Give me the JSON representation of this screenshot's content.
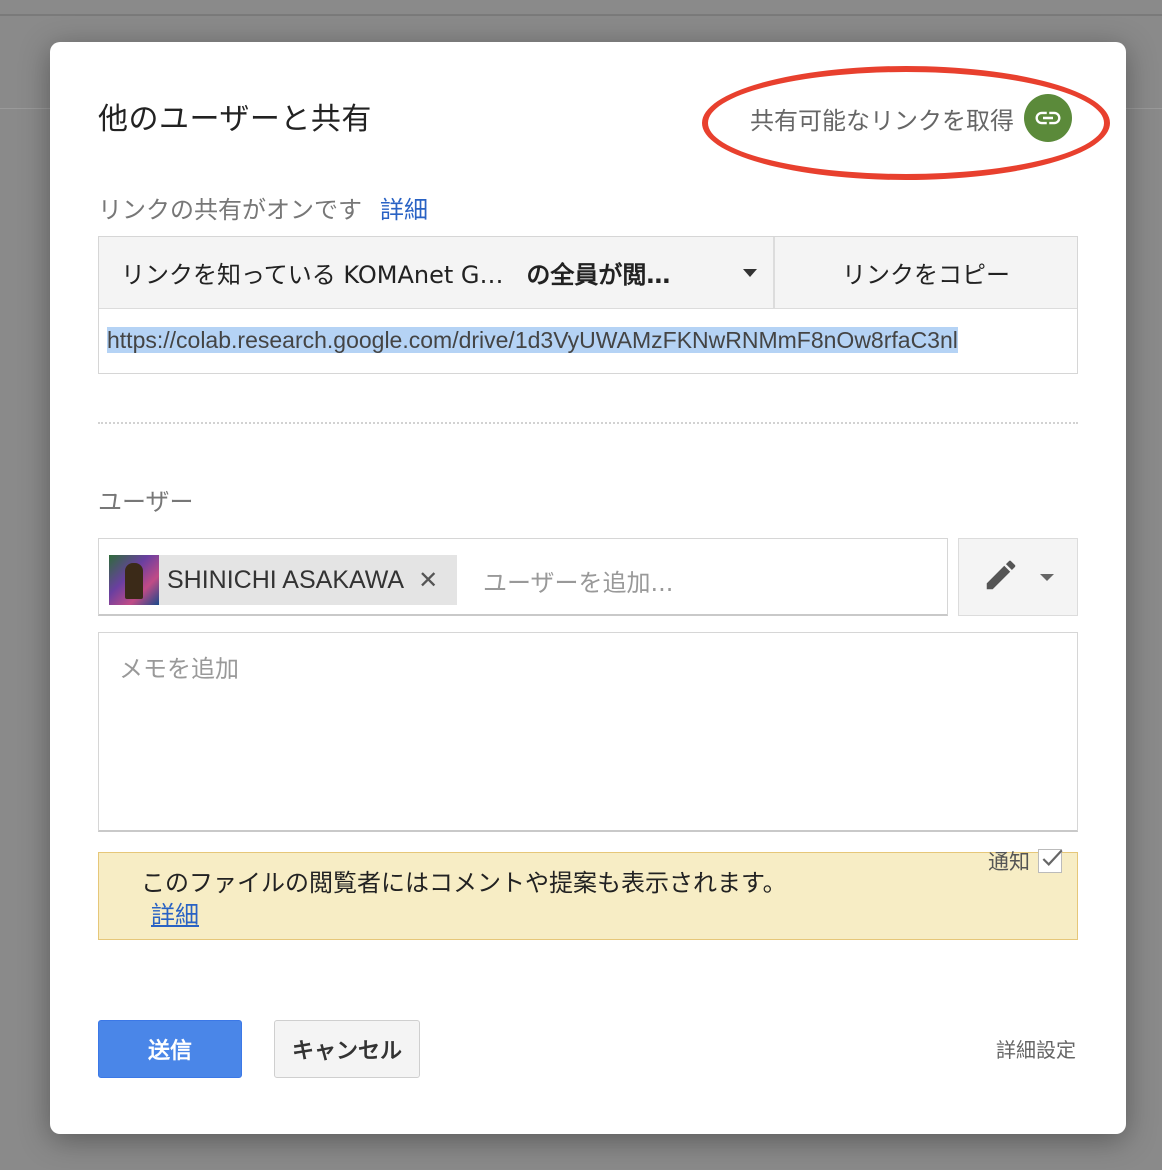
{
  "dialog": {
    "title": "他のユーザーと共有",
    "get_link_label": "共有可能なリンクを取得"
  },
  "link_sharing": {
    "status": "リンクの共有がオンです",
    "detail_link": "詳細",
    "access_prefix": "リンクを知っている KOMAnet G…",
    "access_suffix": "の全員が閲…",
    "copy_button": "リンクをコピー",
    "url": "https://colab.research.google.com/drive/1d3VyUWAMzFKNwRNMmF8nOw8rfaC3nl"
  },
  "users": {
    "label": "ユーザー",
    "chips": [
      {
        "name": "SHINICHI ASAKAWA"
      }
    ],
    "add_placeholder": "ユーザーを追加..."
  },
  "memo": {
    "placeholder": "メモを追加"
  },
  "notify": {
    "label": "通知",
    "checked": true
  },
  "notice": {
    "text": "このファイルの閲覧者にはコメントや提案も表示されます。",
    "link": "詳細"
  },
  "footer": {
    "send": "送信",
    "cancel": "キャンセル",
    "advanced": "詳細設定"
  },
  "colors": {
    "send_button": "#4a86e8",
    "link_icon_bg": "#5b8a3a",
    "highlight_ellipse": "#e8402e",
    "notice_bg": "#f7edc5"
  }
}
